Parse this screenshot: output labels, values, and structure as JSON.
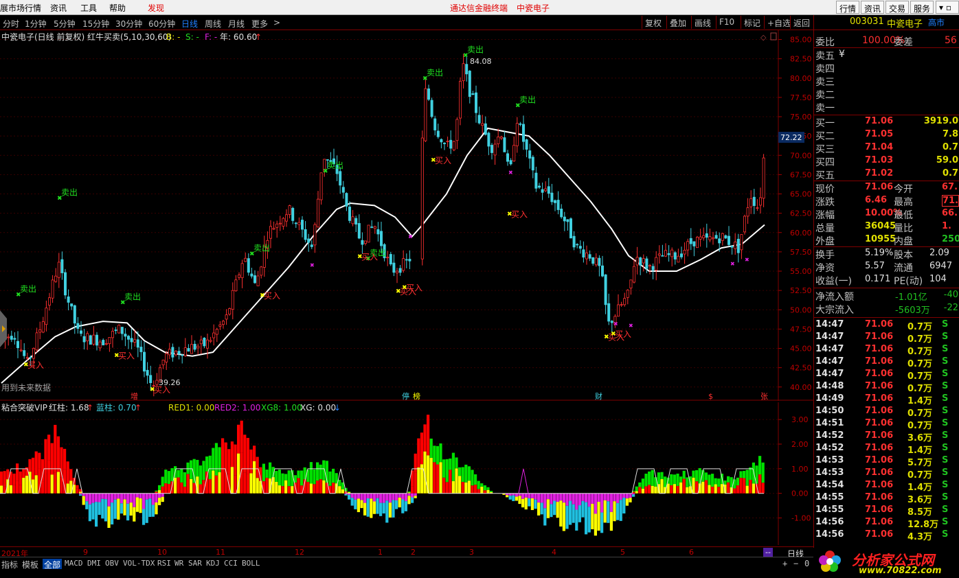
{
  "menubar": {
    "items": [
      "展市场行情",
      "资讯",
      "工具",
      "帮助"
    ],
    "discover": "发现",
    "center_title": "通达信金融终端",
    "center_stock": "中瓷电子",
    "right_buttons": [
      "行情",
      "资讯",
      "交易",
      "服务"
    ]
  },
  "toolbar": {
    "periods": [
      "分时",
      "1分钟",
      "5分钟",
      "15分钟",
      "30分钟",
      "60分钟",
      "日线",
      "周线",
      "月线",
      "更多"
    ],
    "active": "日线",
    "more_arrow": ">",
    "buttons": [
      "复权",
      "叠加",
      "画线",
      "F10",
      "标记",
      "+自选",
      "返回"
    ]
  },
  "main_chart": {
    "header": "中瓷电子(日线 前复权) 红牛买卖(5,10,30,60)",
    "b_label": "B: -",
    "s_label": "S: -",
    "f_label": "F: -",
    "year_label": "年: 60.60",
    "future_note": "用到未来数据",
    "current_price_tag": "72.22",
    "peak_label": "84.08",
    "low_label": "39.26",
    "sell_label": "卖出",
    "buy_label": "买入",
    "y_ticks": [
      "85.00",
      "82.50",
      "80.00",
      "77.50",
      "75.00",
      "72.50",
      "70.00",
      "67.50",
      "65.00",
      "62.50",
      "60.00",
      "57.50",
      "55.00",
      "52.50",
      "50.00",
      "47.50",
      "45.00",
      "42.50",
      "40.00"
    ],
    "ylim": [
      38.2,
      86.2
    ],
    "events": [
      "增",
      "停",
      "榜",
      "财",
      "$",
      "张"
    ]
  },
  "sub_chart": {
    "header": "粘合突破VIP",
    "red_bar": "红柱: 1.68",
    "blue_bar": "蓝柱: 0.70",
    "red1": "RED1: 0.00",
    "red2": "RED2: 1.00",
    "xg8": "XG8: 1.00",
    "xg": "XG: 0.00",
    "y_ticks": [
      "3.00",
      "2.00",
      "1.00",
      "0.00",
      "-1.00"
    ],
    "ylim": [
      -2.1,
      3.7
    ]
  },
  "datebar": {
    "labels": [
      "2021年",
      "9",
      "10",
      "11",
      "12",
      "1",
      "2",
      "3",
      "4",
      "5",
      "6"
    ],
    "end_button": "--",
    "period_label": "日线"
  },
  "indicator_tabs": {
    "items": [
      "指标",
      "模板",
      "全部",
      "MACD",
      "DMI",
      "OBV",
      "VOL-TDX",
      "RSI",
      "WR",
      "SAR",
      "KDJ",
      "CCI",
      "BOLL"
    ],
    "active": "全部",
    "controls": [
      "+",
      "−",
      "0"
    ]
  },
  "quote_panel": {
    "code": "003031",
    "name": "中瓷电子",
    "market": "高市",
    "wb_label": "委比",
    "wb_value": "100.00%",
    "wc_label": "委差",
    "wc_value": "56",
    "asks": [
      {
        "label": "卖五",
        "price": "¥"
      },
      {
        "label": "卖四",
        "price": ""
      },
      {
        "label": "卖三",
        "price": ""
      },
      {
        "label": "卖二",
        "price": ""
      },
      {
        "label": "卖一",
        "price": ""
      }
    ],
    "bids": [
      {
        "label": "买一",
        "price": "71.06",
        "vol": "3919.0"
      },
      {
        "label": "买二",
        "price": "71.05",
        "vol": "7.8"
      },
      {
        "label": "买三",
        "price": "71.04",
        "vol": "0.7"
      },
      {
        "label": "买四",
        "price": "71.03",
        "vol": "59.0"
      },
      {
        "label": "买五",
        "price": "71.02",
        "vol": "0.7"
      }
    ],
    "stats": [
      {
        "l1": "现价",
        "v1": "71.06",
        "l2": "今开",
        "v2": "67."
      },
      {
        "l1": "涨跌",
        "v1": "6.46",
        "l2": "最高",
        "v2": "71."
      },
      {
        "l1": "涨幅",
        "v1": "10.00%",
        "l2": "最低",
        "v2": "66."
      },
      {
        "l1": "总量",
        "v1": "36045",
        "l2": "量比",
        "v2": "1."
      },
      {
        "l1": "外盘",
        "v1": "10955",
        "l2": "内盘",
        "v2": "250"
      }
    ],
    "fin": [
      {
        "l1": "换手",
        "v1": "5.19%",
        "l2": "股本",
        "v2": "2.09"
      },
      {
        "l1": "净资",
        "v1": "5.57",
        "l2": "流通",
        "v2": "6947"
      },
      {
        "l1": "收益(一)",
        "v1": "0.171",
        "l2": "PE(动)",
        "v2": "104"
      }
    ],
    "flow": [
      {
        "label": "净流入额",
        "v1": "-1.01亿",
        "v2": "-40"
      },
      {
        "label": "大宗流入",
        "v1": "-5603万",
        "v2": "-22"
      }
    ],
    "ticks": [
      {
        "t": "14:47",
        "p": "71.06",
        "v": "0.7万",
        "s": "S"
      },
      {
        "t": "14:47",
        "p": "71.06",
        "v": "0.7万",
        "s": "S"
      },
      {
        "t": "14:47",
        "p": "71.06",
        "v": "0.7万",
        "s": "S"
      },
      {
        "t": "14:47",
        "p": "71.06",
        "v": "0.7万",
        "s": "S"
      },
      {
        "t": "14:47",
        "p": "71.06",
        "v": "0.7万",
        "s": "S"
      },
      {
        "t": "14:48",
        "p": "71.06",
        "v": "0.7万",
        "s": "S"
      },
      {
        "t": "14:49",
        "p": "71.06",
        "v": "1.4万",
        "s": "S"
      },
      {
        "t": "14:50",
        "p": "71.06",
        "v": "0.7万",
        "s": "S"
      },
      {
        "t": "14:51",
        "p": "71.06",
        "v": "0.7万",
        "s": "S"
      },
      {
        "t": "14:52",
        "p": "71.06",
        "v": "3.6万",
        "s": "S"
      },
      {
        "t": "14:52",
        "p": "71.06",
        "v": "1.4万",
        "s": "S"
      },
      {
        "t": "14:53",
        "p": "71.06",
        "v": "5.7万",
        "s": "S"
      },
      {
        "t": "14:53",
        "p": "71.06",
        "v": "0.7万",
        "s": "S"
      },
      {
        "t": "14:54",
        "p": "71.06",
        "v": "1.4万",
        "s": "S"
      },
      {
        "t": "14:55",
        "p": "71.06",
        "v": "3.6万",
        "s": "S"
      },
      {
        "t": "14:55",
        "p": "71.06",
        "v": "8.5万",
        "s": "S"
      },
      {
        "t": "14:56",
        "p": "71.06",
        "v": "12.8万",
        "s": "S"
      },
      {
        "t": "14:56",
        "p": "71.06",
        "v": "4.3万",
        "s": "S"
      }
    ]
  },
  "logo": {
    "title": "分析家公式网",
    "url": "www.70822.com"
  },
  "colors": {
    "up": "#ff3030",
    "down": "#40d0e0",
    "ma": "#ffffff",
    "sell_text": "#20e020",
    "buy_text": "#ff3030",
    "sub_red": "#ff0000",
    "sub_green": "#00e000",
    "sub_yellow": "#ffff00",
    "sub_cyan": "#20c0e0",
    "sub_magenta": "#e020e0"
  }
}
